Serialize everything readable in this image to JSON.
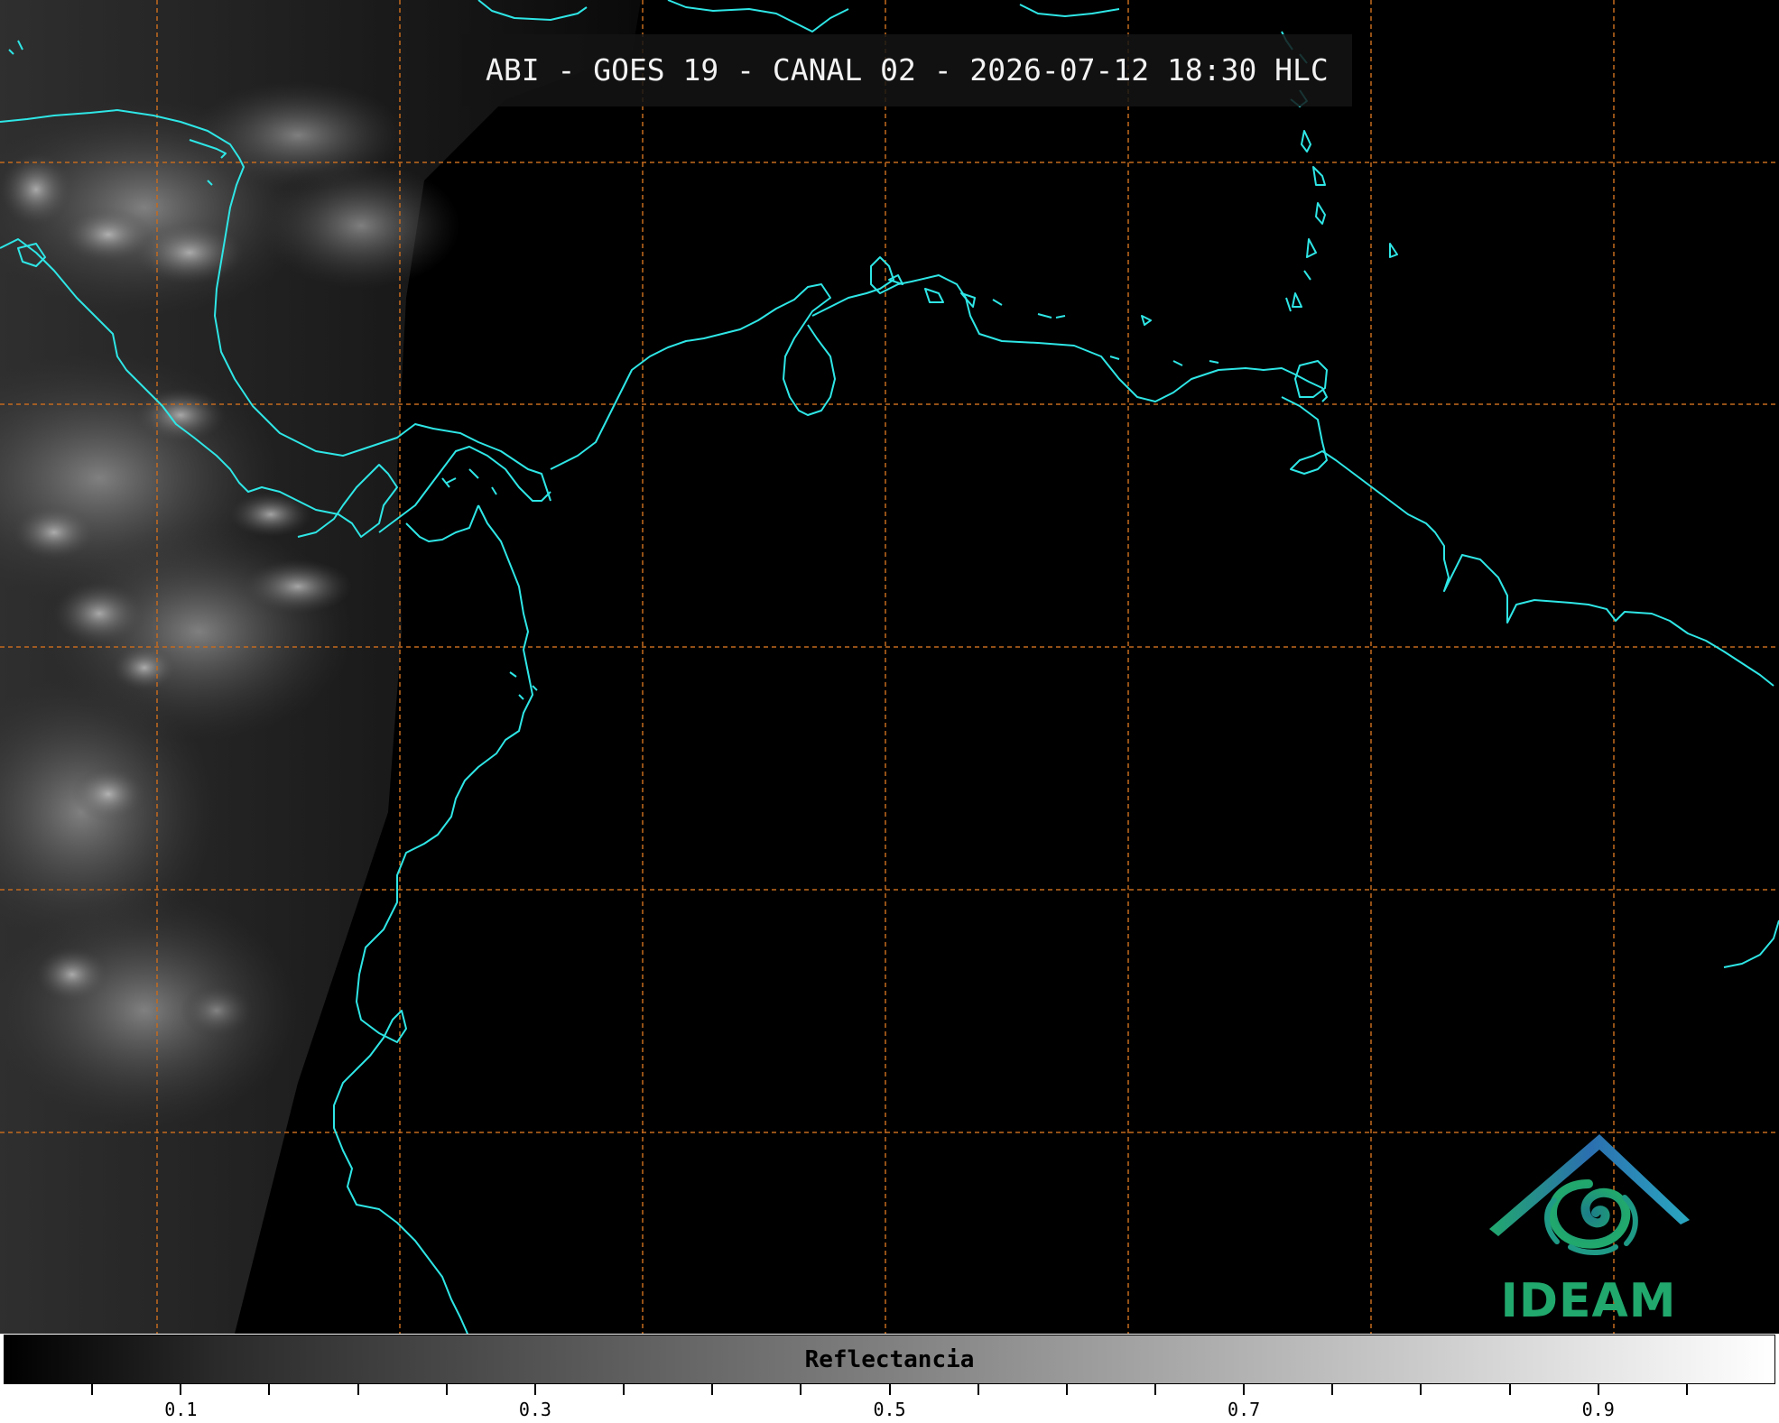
{
  "title": "ABI - GOES 19 - CANAL 02 - 2026-07-12 18:30 HLC",
  "colorbar": {
    "label": "Reflectancia",
    "range": [
      0.0,
      1.0
    ],
    "major_ticks": [
      "0.1",
      "0.3",
      "0.5",
      "0.7",
      "0.9"
    ],
    "colors": {
      "start": "#000000",
      "end": "#ffffff"
    }
  },
  "logo": {
    "text": "IDEAM",
    "icon": "ideam-logo-icon",
    "color": "#21a86d"
  },
  "colors": {
    "coastline": "#2fe6e6",
    "gridline": "#c46a1e",
    "background": "#000000"
  }
}
